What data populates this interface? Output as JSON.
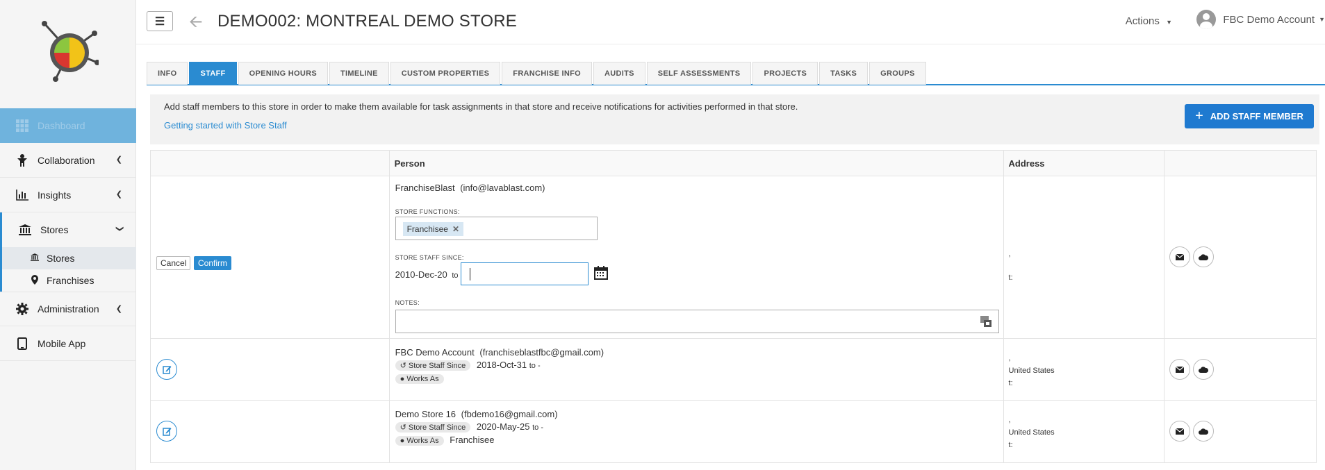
{
  "header": {
    "title": "DEMO002: MONTREAL DEMO STORE",
    "actions_label": "Actions",
    "account_label": "FBC Demo Account"
  },
  "sidebar": {
    "items": [
      {
        "label": "Dashboard",
        "icon": "dashboard-grid-icon"
      },
      {
        "label": "Collaboration",
        "icon": "person-icon"
      },
      {
        "label": "Insights",
        "icon": "bar-chart-icon"
      },
      {
        "label": "Stores",
        "icon": "bank-icon"
      },
      {
        "label": "Administration",
        "icon": "gear-icon"
      },
      {
        "label": "Mobile App",
        "icon": "tablet-icon"
      }
    ],
    "sub_items": [
      {
        "label": "Stores",
        "icon": "bank-icon"
      },
      {
        "label": "Franchises",
        "icon": "map-pin-icon"
      }
    ]
  },
  "tabs": [
    {
      "label": "INFO"
    },
    {
      "label": "STAFF"
    },
    {
      "label": "OPENING HOURS"
    },
    {
      "label": "TIMELINE"
    },
    {
      "label": "CUSTOM PROPERTIES"
    },
    {
      "label": "FRANCHISE INFO"
    },
    {
      "label": "AUDITS"
    },
    {
      "label": "SELF ASSESSMENTS"
    },
    {
      "label": "PROJECTS"
    },
    {
      "label": "TASKS"
    },
    {
      "label": "GROUPS"
    }
  ],
  "info": {
    "text": "Add staff members to this store in order to make them available for task assignments in that store and receive notifications for activities performed in that store.",
    "link": "Getting started with Store Staff",
    "add_button": "ADD STAFF MEMBER"
  },
  "table": {
    "columns": [
      "",
      "Person",
      "Address",
      ""
    ],
    "editing_row": {
      "cancel": "Cancel",
      "confirm": "Confirm",
      "name": "FranchiseBlast",
      "email": "(info@lavablast.com)",
      "functions_label": "STORE FUNCTIONS:",
      "function_chip": "Franchisee",
      "since_label": "STORE STAFF SINCE:",
      "since_date": "2010-Dec-20",
      "to": "to",
      "notes_label": "NOTES:",
      "addr_line1": ",",
      "addr_line2": "t:"
    },
    "rows": [
      {
        "name": "FBC Demo Account",
        "email": "(franchiseblastfbc@gmail.com)",
        "since_pill": "Store Staff Since",
        "since_date": "2018-Oct-31",
        "to": "to -",
        "works_pill": "Works As",
        "works_value": "",
        "addr_line1": ",",
        "addr_line2": "United States",
        "addr_line3": "t:"
      },
      {
        "name": "Demo Store 16",
        "email": "(fbdemo16@gmail.com)",
        "since_pill": "Store Staff Since",
        "since_date": "2020-May-25",
        "to": "to -",
        "works_pill": "Works As",
        "works_value": "Franchisee",
        "addr_line1": ",",
        "addr_line2": "United States",
        "addr_line3": "t:"
      }
    ]
  }
}
